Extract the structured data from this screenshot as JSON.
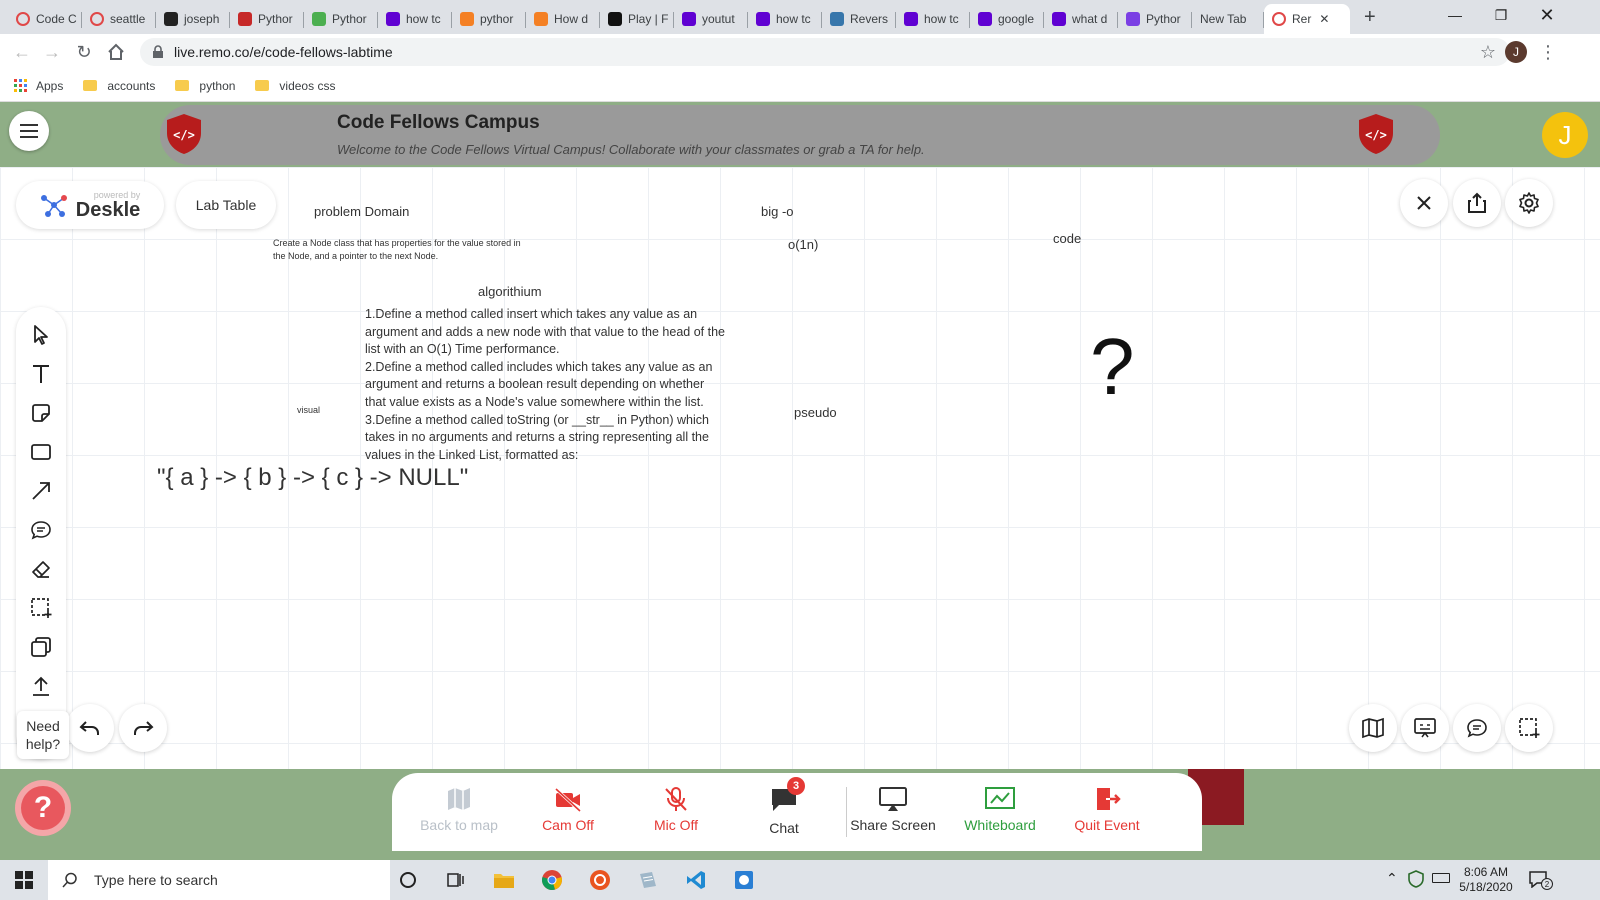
{
  "browser": {
    "tabs": [
      {
        "label": "Code C",
        "icon": "remo-icon"
      },
      {
        "label": "seattle",
        "icon": "remo-icon"
      },
      {
        "label": "joseph",
        "icon": "github-icon"
      },
      {
        "label": "Pythor",
        "icon": "codefellows-icon"
      },
      {
        "label": "Pythor",
        "icon": "w3schools-icon"
      },
      {
        "label": "how tc",
        "icon": "yahoo-icon"
      },
      {
        "label": "pythor",
        "icon": "stackoverflow-icon"
      },
      {
        "label": "How d",
        "icon": "stackoverflow-icon"
      },
      {
        "label": "Play | F",
        "icon": "play-icon"
      },
      {
        "label": "youtut",
        "icon": "yahoo-icon"
      },
      {
        "label": "how tc",
        "icon": "yahoo-icon"
      },
      {
        "label": "Revers",
        "icon": "python-icon"
      },
      {
        "label": "how tc",
        "icon": "yahoo-icon"
      },
      {
        "label": "google",
        "icon": "yahoo-icon"
      },
      {
        "label": "what d",
        "icon": "yahoo-icon"
      },
      {
        "label": "Pythor",
        "icon": "p-icon"
      },
      {
        "label": "New Tab",
        "icon": ""
      },
      {
        "label": "Rer",
        "icon": "remo-icon",
        "active": true
      }
    ],
    "new_tab_label": "+",
    "url": "live.remo.co/e/code-fellows-labtime",
    "profile_initial": "J",
    "bookmarks": [
      {
        "label": "Apps",
        "icon": "apps-grid-icon"
      },
      {
        "label": "accounts",
        "icon": "folder-icon"
      },
      {
        "label": "python",
        "icon": "folder-icon"
      },
      {
        "label": "videos css",
        "icon": "folder-icon"
      }
    ]
  },
  "header": {
    "title": "Code Fellows Campus",
    "subtitle": "Welcome to the Code Fellows Virtual Campus! Collaborate with your classmates or grab a TA for help.",
    "avatar_initial": "J"
  },
  "deskle": {
    "powered_by": "powered by",
    "brand": "Deskle",
    "board_name": "Lab Table"
  },
  "whiteboard": {
    "problem_domain_label": "problem Domain",
    "problem_text_line1": "Create a Node class that has properties for the value stored in",
    "problem_text_line2": "the Node, and a pointer to the next Node.",
    "bigo_label": "big -o",
    "bigo_value": "o(1n)",
    "code_label": "code",
    "algorithm_label": "algorithium",
    "algorithm_lines": [
      "1.Define a method called insert which takes any value as an",
      "argument and adds a new node with that value to the head of the",
      "list with an O(1) Time performance.",
      "2.Define a method called includes which takes any value as an",
      "argument and returns a boolean result depending on whether",
      "that value exists as a Node's value somewhere within the list.",
      "3.Define a method called toString (or __str__ in Python) which",
      "takes in no arguments and returns a string representing all the",
      "values in the Linked List, formatted as:"
    ],
    "visual_label": "visual",
    "pseudo_label": "pseudo",
    "question_mark": "?",
    "linked_list_text": "\"{ a } -> { b } -> { c } -> NULL\""
  },
  "help": {
    "line1": "Need",
    "line2": "help?"
  },
  "event_bar": {
    "buttons": [
      {
        "label": "Back to map",
        "color": "#b9c0c8"
      },
      {
        "label": "Cam Off",
        "color": "#e53935"
      },
      {
        "label": "Mic Off",
        "color": "#e53935"
      },
      {
        "label": "Chat",
        "color": "#333333"
      },
      {
        "label": "Share Screen",
        "color": "#333333"
      },
      {
        "label": "Whiteboard",
        "color": "#2e9e3e"
      },
      {
        "label": "Quit Event",
        "color": "#e53935"
      }
    ],
    "chat_badge": "3"
  },
  "taskbar": {
    "search_placeholder": "Type here to search",
    "time": "8:06 AM",
    "date": "5/18/2020",
    "notification_count": "2"
  }
}
